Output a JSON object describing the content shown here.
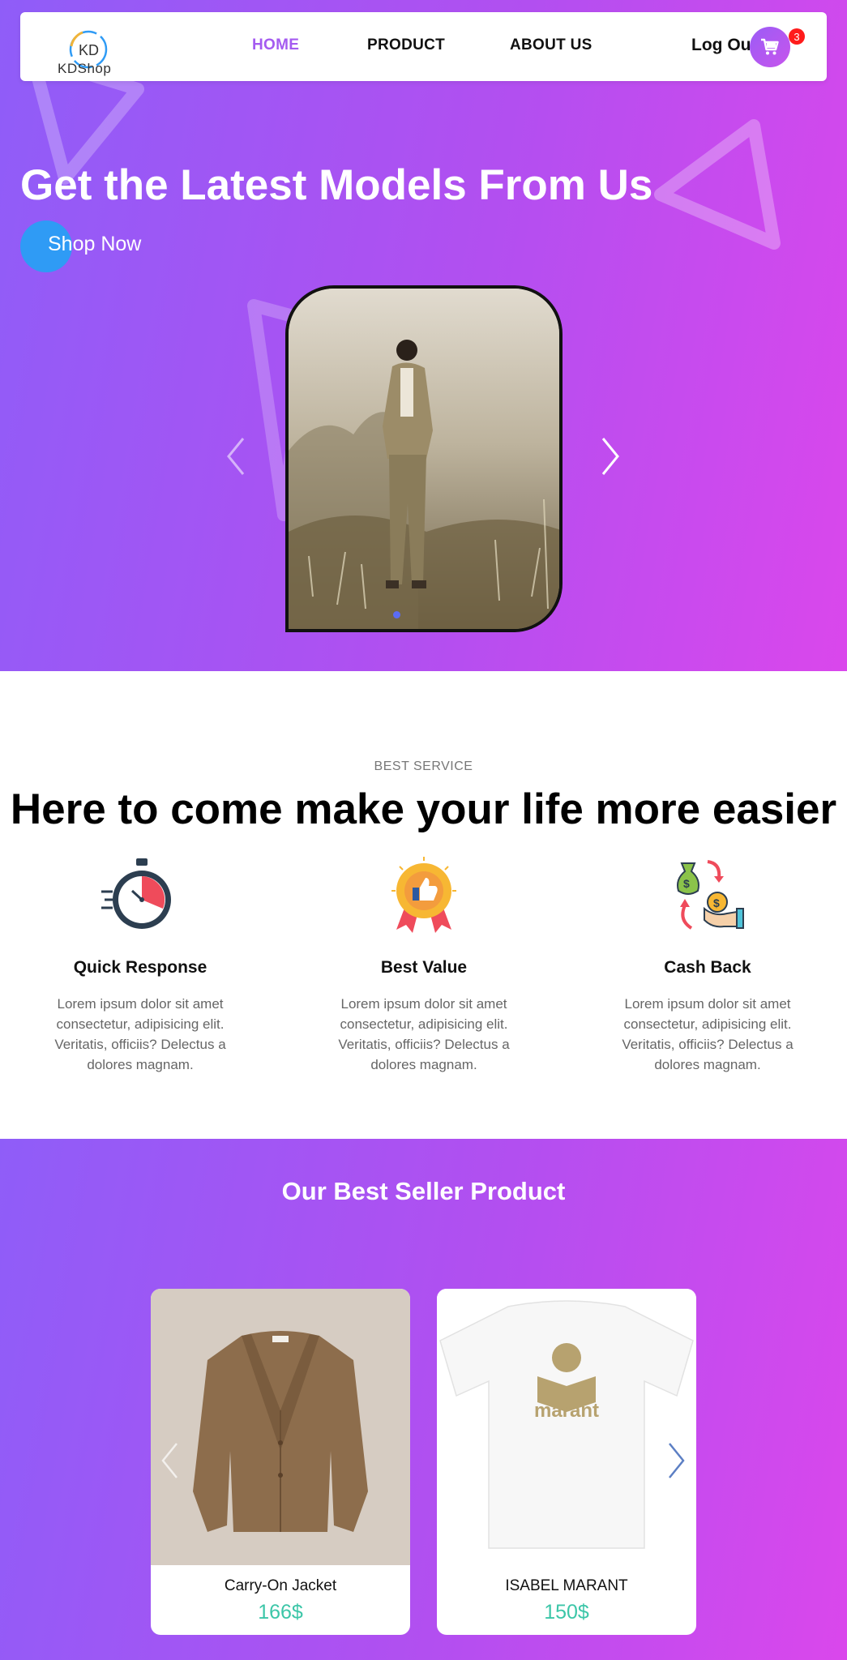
{
  "brand": {
    "name": "KDShop",
    "logo_letters": "KD"
  },
  "nav": {
    "items": [
      {
        "label": "HOME",
        "active": true
      },
      {
        "label": "PRODUCT",
        "active": false
      },
      {
        "label": "ABOUT US",
        "active": false
      }
    ],
    "logout_label": "Log Out",
    "cart_count": "3",
    "cart_icon": "cart-icon"
  },
  "hero": {
    "title": "Get the Latest Models From Us",
    "cta_label": "Shop Now",
    "slider": {
      "active_slide": 1,
      "prev_icon": "chevron-left-icon",
      "next_icon": "chevron-right-icon"
    }
  },
  "service": {
    "eyebrow": "BEST SERVICE",
    "title": "Here to come make your life more easier",
    "features": [
      {
        "icon": "stopwatch-icon",
        "title": "Quick Response",
        "desc": "Lorem ipsum dolor sit amet consectetur, adipisicing elit. Veritatis, officiis? Delectus a dolores magnam."
      },
      {
        "icon": "badge-thumbs-up-icon",
        "title": "Best Value",
        "desc": "Lorem ipsum dolor sit amet consectetur, adipisicing elit. Veritatis, officiis? Delectus a dolores magnam."
      },
      {
        "icon": "cash-back-icon",
        "title": "Cash Back",
        "desc": "Lorem ipsum dolor sit amet consectetur, adipisicing elit. Veritatis, officiis? Delectus a dolores magnam."
      }
    ]
  },
  "best_seller": {
    "title": "Our Best Seller Product",
    "products": [
      {
        "name": "Carry-On Jacket",
        "price": "166$"
      },
      {
        "name": "ISABEL MARANT",
        "price": "150$",
        "print_text": "marant"
      }
    ]
  },
  "colors": {
    "gradient_start": "#8f5df8",
    "gradient_end": "#da47ec",
    "nav_active": "#a45bf0",
    "price": "#3cc6a8",
    "cta_circle": "#2f9bf5",
    "badge": "#ff1b1b"
  }
}
